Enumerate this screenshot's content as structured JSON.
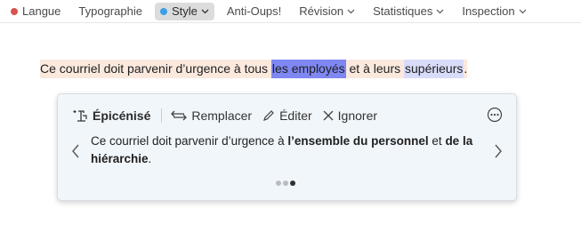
{
  "toolbar": {
    "items": [
      {
        "label": "Langue",
        "dot_color": "#d9534f",
        "has_dot": true,
        "dropdown": false,
        "active": false
      },
      {
        "label": "Typographie",
        "has_dot": false,
        "dropdown": false,
        "active": false
      },
      {
        "label": "Style",
        "dot_color": "#3aa0e8",
        "has_dot": true,
        "dropdown": true,
        "active": true
      },
      {
        "label": "Anti-Oups!",
        "has_dot": false,
        "dropdown": false,
        "active": false
      },
      {
        "label": "Révision",
        "has_dot": false,
        "dropdown": true,
        "active": false
      },
      {
        "label": "Statistiques",
        "has_dot": false,
        "dropdown": true,
        "active": false
      },
      {
        "label": "Inspection",
        "has_dot": false,
        "dropdown": true,
        "active": false
      }
    ]
  },
  "document": {
    "sentence": {
      "part1": "Ce courriel doit parvenir d’urgence à tous ",
      "highlight1": "les employés",
      "part2": " et à leurs ",
      "highlight2": "supérieurs",
      "part3": "."
    }
  },
  "card": {
    "actions": {
      "epicenise": "Épicénisé",
      "replace": "Remplacer",
      "edit": "Éditer",
      "ignore": "Ignorer"
    },
    "suggestion": {
      "part1": "Ce courriel doit parvenir d’urgence à ",
      "bold1": "l’ensemble du personnel",
      "part2": " et ",
      "bold2": "de la hiérarchie",
      "part3": "."
    },
    "pager": {
      "total": 3,
      "current": 3
    }
  },
  "colors": {
    "sentence_bg": "#fbe9de",
    "highlight_strong": "#7e87f2",
    "highlight_soft": "#d9dcf8",
    "card_bg": "#f1f6fa"
  }
}
